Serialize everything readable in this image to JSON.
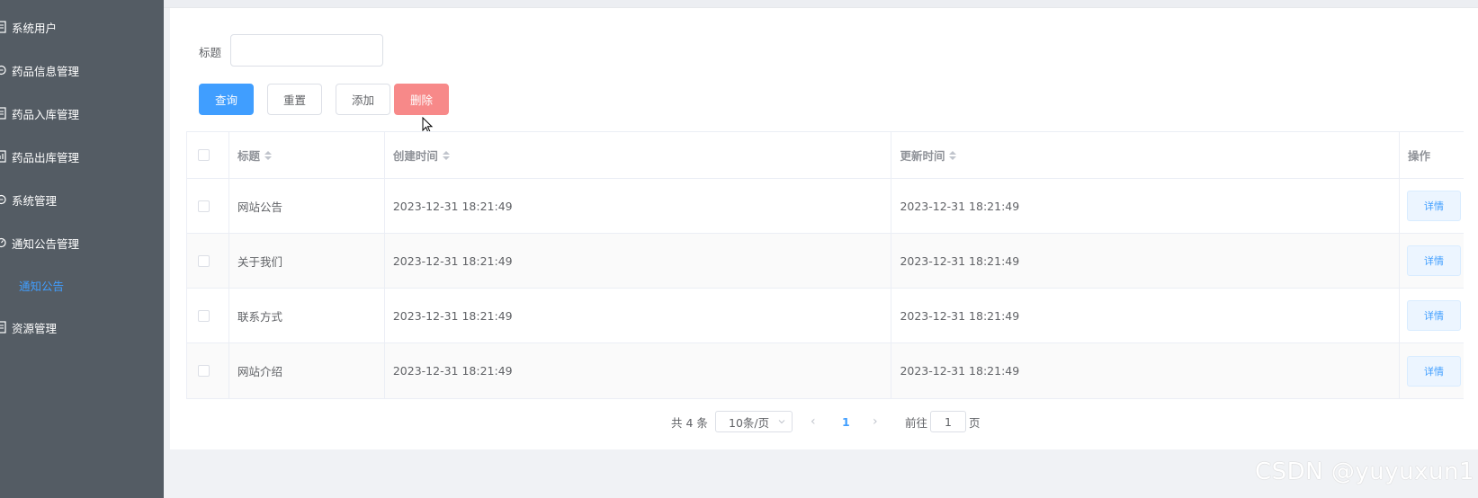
{
  "sidebar": {
    "items": [
      {
        "label": "系统用户",
        "icon": "list-icon"
      },
      {
        "label": "药品信息管理",
        "icon": "circle-icon"
      },
      {
        "label": "药品入库管理",
        "icon": "list-icon"
      },
      {
        "label": "药品出库管理",
        "icon": "chart-icon"
      },
      {
        "label": "系统管理",
        "icon": "circle-icon"
      },
      {
        "label": "通知公告管理",
        "icon": "clock-icon"
      },
      {
        "label": "资源管理",
        "icon": "list-icon"
      }
    ],
    "subitem": {
      "label": "通知公告"
    }
  },
  "search": {
    "label": "标题",
    "value": "",
    "placeholder": ""
  },
  "buttons": {
    "query": "查询",
    "reset": "重置",
    "add": "添加",
    "delete": "删除"
  },
  "table": {
    "headers": {
      "title": "标题",
      "created": "创建时间",
      "updated": "更新时间",
      "op": "操作"
    },
    "rows": [
      {
        "title": "网站公告",
        "created": "2023-12-31 18:21:49",
        "updated": "2023-12-31 18:21:49",
        "action": "详情"
      },
      {
        "title": "关于我们",
        "created": "2023-12-31 18:21:49",
        "updated": "2023-12-31 18:21:49",
        "action": "详情"
      },
      {
        "title": "联系方式",
        "created": "2023-12-31 18:21:49",
        "updated": "2023-12-31 18:21:49",
        "action": "详情"
      },
      {
        "title": "网站介绍",
        "created": "2023-12-31 18:21:49",
        "updated": "2023-12-31 18:21:49",
        "action": "详情"
      }
    ]
  },
  "pagination": {
    "total": "共 4 条",
    "page_size": "10条/页",
    "prev": "‹",
    "current": "1",
    "next": "›",
    "goto": "前往",
    "jump_value": "1",
    "page_suffix": "页"
  },
  "watermark": "CSDN @yuyuxun1",
  "colors": {
    "sidebar": "#545c64",
    "primary": "#409eff",
    "danger": "#f78989",
    "active_submenu": "#409eff"
  }
}
